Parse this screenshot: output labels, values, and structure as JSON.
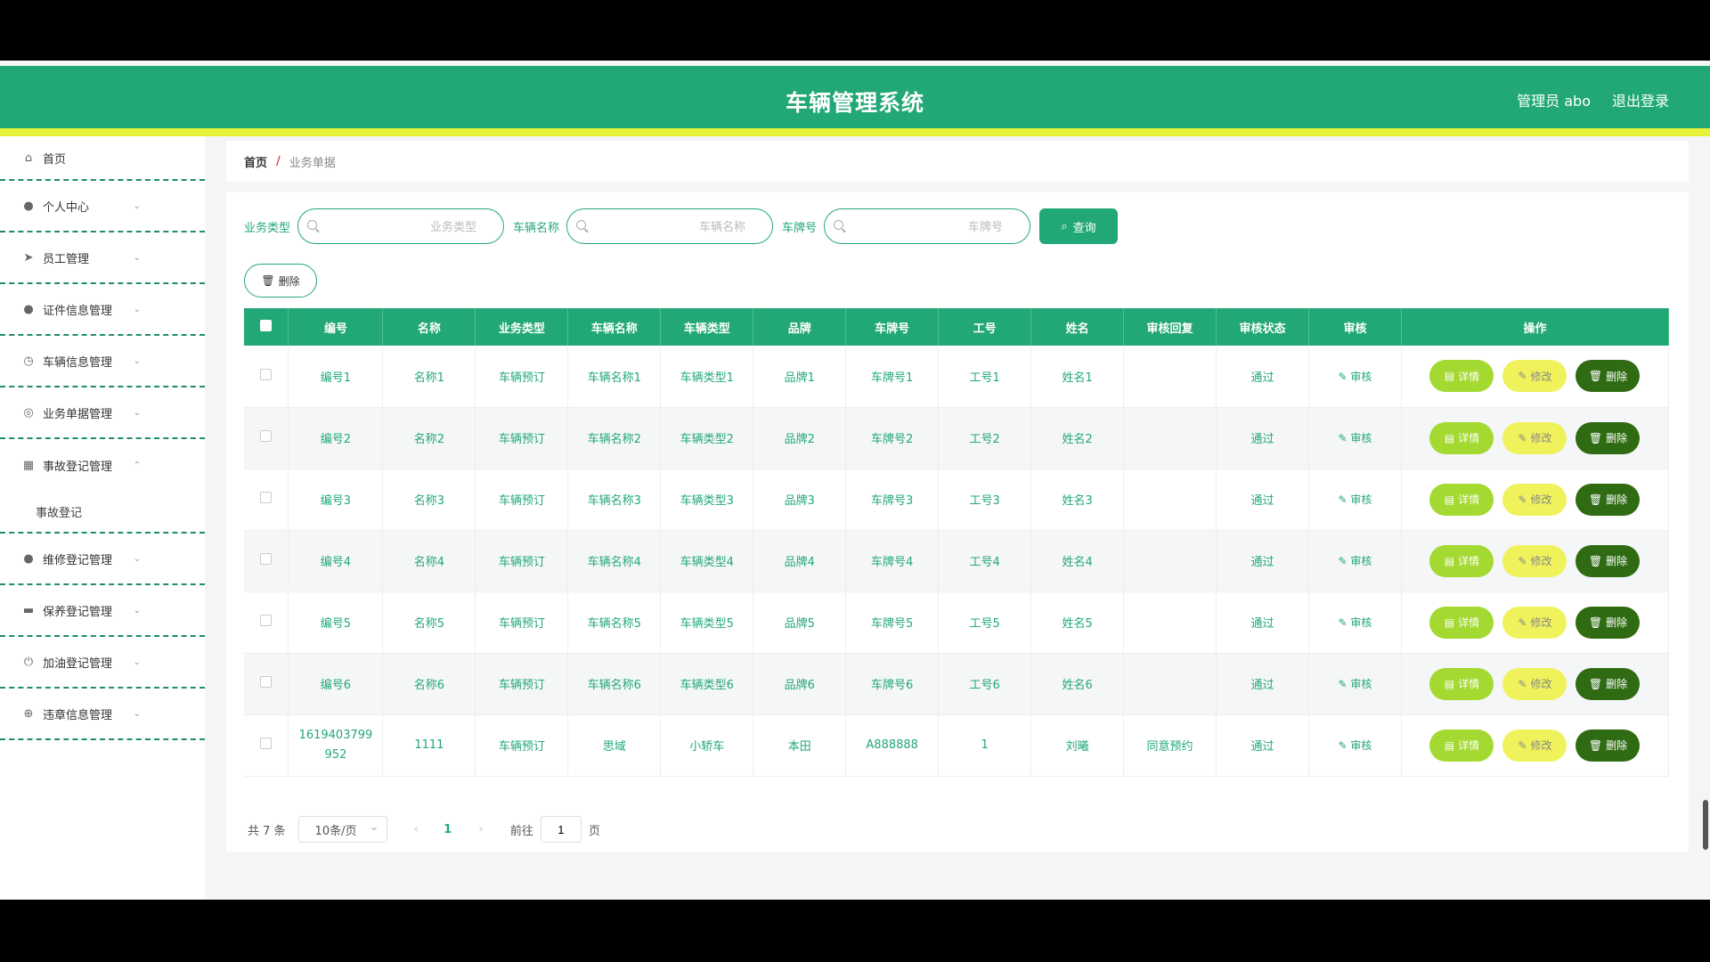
{
  "header": {
    "title": "车辆管理系统",
    "user_label": "管理员 abo",
    "logout_label": "退出登录"
  },
  "sidebar": {
    "items": [
      {
        "label": "首页",
        "icon": "home-icon"
      },
      {
        "label": "个人中心",
        "icon": "user-icon"
      },
      {
        "label": "员工管理",
        "icon": "send-icon"
      },
      {
        "label": "证件信息管理",
        "icon": "user-icon"
      },
      {
        "label": "车辆信息管理",
        "icon": "clock-icon"
      },
      {
        "label": "业务单据管理",
        "icon": "compass-icon"
      },
      {
        "label": "事故登记管理",
        "icon": "grid-icon"
      },
      {
        "label": "维修登记管理",
        "icon": "pin-icon"
      },
      {
        "label": "保养登记管理",
        "icon": "briefcase-icon"
      },
      {
        "label": "加油登记管理",
        "icon": "power-icon"
      },
      {
        "label": "违章信息管理",
        "icon": "globe-icon"
      }
    ],
    "sub_item": "事故登记"
  },
  "breadcrumb": {
    "home": "首页",
    "separator": "/",
    "current": "业务单据"
  },
  "search": {
    "type_label": "业务类型",
    "type_placeholder": "业务类型",
    "name_label": "车辆名称",
    "name_placeholder": "车辆名称",
    "plate_label": "车牌号",
    "plate_placeholder": "车牌号",
    "query_label": "查询"
  },
  "actions": {
    "delete_label": "删除"
  },
  "table": {
    "headers": [
      "编号",
      "名称",
      "业务类型",
      "车辆名称",
      "车辆类型",
      "品牌",
      "车牌号",
      "工号",
      "姓名",
      "审核回复",
      "审核状态",
      "审核",
      "操作"
    ],
    "audit_label": "审核",
    "detail_label": "详情",
    "edit_label": "修改",
    "del_label": "删除",
    "rows": [
      [
        "编号1",
        "名称1",
        "车辆预订",
        "车辆名称1",
        "车辆类型1",
        "品牌1",
        "车牌号1",
        "工号1",
        "姓名1",
        "",
        "通过"
      ],
      [
        "编号2",
        "名称2",
        "车辆预订",
        "车辆名称2",
        "车辆类型2",
        "品牌2",
        "车牌号2",
        "工号2",
        "姓名2",
        "",
        "通过"
      ],
      [
        "编号3",
        "名称3",
        "车辆预订",
        "车辆名称3",
        "车辆类型3",
        "品牌3",
        "车牌号3",
        "工号3",
        "姓名3",
        "",
        "通过"
      ],
      [
        "编号4",
        "名称4",
        "车辆预订",
        "车辆名称4",
        "车辆类型4",
        "品牌4",
        "车牌号4",
        "工号4",
        "姓名4",
        "",
        "通过"
      ],
      [
        "编号5",
        "名称5",
        "车辆预订",
        "车辆名称5",
        "车辆类型5",
        "品牌5",
        "车牌号5",
        "工号5",
        "姓名5",
        "",
        "通过"
      ],
      [
        "编号6",
        "名称6",
        "车辆预订",
        "车辆名称6",
        "车辆类型6",
        "品牌6",
        "车牌号6",
        "工号6",
        "姓名6",
        "",
        "通过"
      ],
      [
        "1619403799952",
        "1111",
        "车辆预订",
        "思域",
        "小轿车",
        "本田",
        "A888888",
        "1",
        "刘曦",
        "同意预约",
        "通过"
      ]
    ]
  },
  "pagination": {
    "total": "共 7 条",
    "page_size": "10条/页",
    "prev": "‹",
    "current_page": "1",
    "next": "›",
    "goto_prefix": "前往",
    "goto_value": "1",
    "goto_suffix": "页"
  },
  "colors": {
    "primary": "#22a876",
    "accent_stripe": "#e8f23a",
    "detail_btn": "#a3d930",
    "edit_btn": "#f0f25c",
    "delete_btn": "#2e6b12"
  }
}
